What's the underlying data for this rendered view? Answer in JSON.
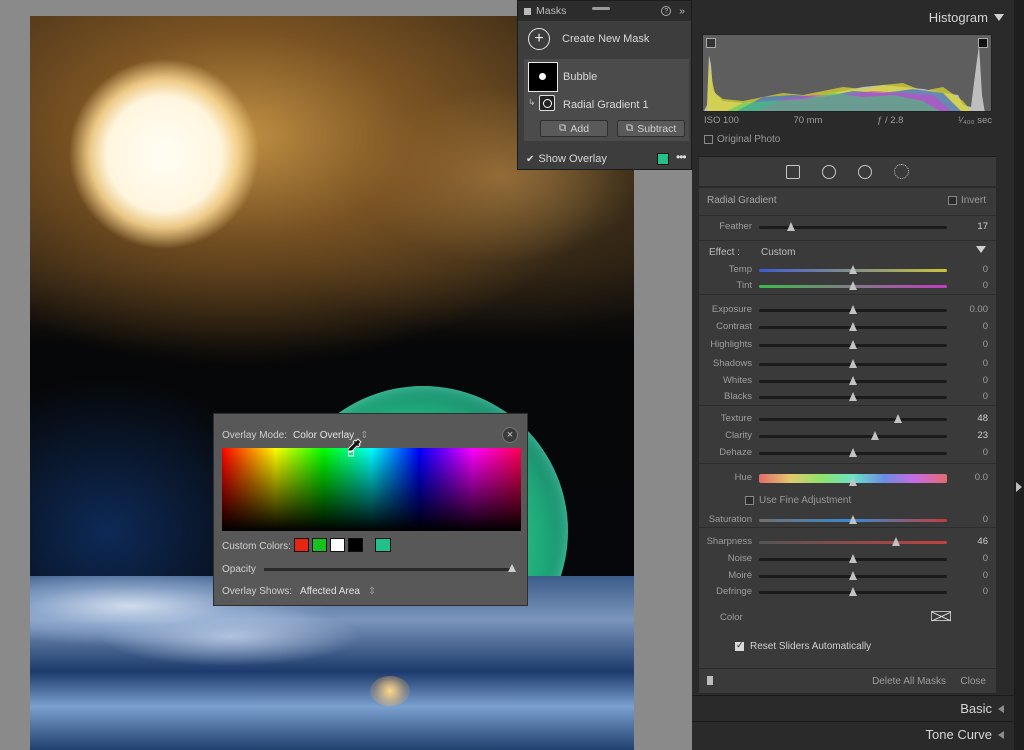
{
  "masks_panel": {
    "title": "Masks",
    "create_label": "Create New Mask",
    "mask_name": "Bubble",
    "component_name": "Radial Gradient 1",
    "add_label": "Add",
    "subtract_label": "Subtract",
    "show_overlay_label": "Show Overlay",
    "show_overlay_checked": true,
    "overlay_color": "#22c08a"
  },
  "histogram": {
    "title": "Histogram",
    "iso": "ISO 100",
    "focal": "70 mm",
    "aperture": "ƒ / 2.8",
    "shutter": "¹⁄₄₀₀ sec",
    "original_photo_label": "Original Photo"
  },
  "tools": [
    "crop-icon",
    "heal-icon",
    "redeye-icon",
    "mask-icon"
  ],
  "mask_editor": {
    "type_label": "Radial Gradient",
    "invert_label": "Invert",
    "feather": {
      "label": "Feather",
      "value": "17",
      "pos": 0.17
    },
    "effect_label": "Effect :",
    "effect_value": "Custom",
    "sliders": [
      {
        "label": "Temp",
        "value": "0",
        "pos": 0.5,
        "track": "temp"
      },
      {
        "label": "Tint",
        "value": "0",
        "pos": 0.5,
        "track": "tint"
      },
      {
        "label": "Exposure",
        "value": "0.00",
        "pos": 0.5,
        "track": "plain"
      },
      {
        "label": "Contrast",
        "value": "0",
        "pos": 0.5,
        "track": "plain"
      },
      {
        "label": "Highlights",
        "value": "0",
        "pos": 0.5,
        "track": "plain"
      },
      {
        "label": "Shadows",
        "value": "0",
        "pos": 0.5,
        "track": "plain"
      },
      {
        "label": "Whites",
        "value": "0",
        "pos": 0.5,
        "track": "plain"
      },
      {
        "label": "Blacks",
        "value": "0",
        "pos": 0.5,
        "track": "plain"
      },
      {
        "label": "Texture",
        "value": "48",
        "pos": 0.74,
        "track": "plain",
        "hi": true
      },
      {
        "label": "Clarity",
        "value": "23",
        "pos": 0.615,
        "track": "plain",
        "hi": true
      },
      {
        "label": "Dehaze",
        "value": "0",
        "pos": 0.5,
        "track": "plain"
      },
      {
        "label": "Saturation",
        "value": "0",
        "pos": 0.5,
        "track": "sat"
      },
      {
        "label": "Sharpness",
        "value": "46",
        "pos": 0.73,
        "track": "sharp",
        "hi": true
      },
      {
        "label": "Noise",
        "value": "0",
        "pos": 0.5,
        "track": "plain"
      },
      {
        "label": "Moiré",
        "value": "0",
        "pos": 0.5,
        "track": "plain"
      },
      {
        "label": "Defringe",
        "value": "0",
        "pos": 0.5,
        "track": "plain"
      }
    ],
    "hue": {
      "label": "Hue",
      "value": "0.0",
      "pos": 0.5
    },
    "fine_adjustment_label": "Use Fine Adjustment",
    "color_label": "Color",
    "reset_label": "Reset Sliders Automatically",
    "reset_checked": true,
    "delete_all_label": "Delete All Masks",
    "close_label": "Close"
  },
  "sections": {
    "basic": "Basic",
    "tone_curve": "Tone Curve"
  },
  "overlay_popup": {
    "mode_label": "Overlay Mode:",
    "mode_value": "Color Overlay",
    "custom_colors_label": "Custom Colors:",
    "custom_colors": [
      "#e8250e",
      "#15c41a",
      "#ffffff",
      "#000000"
    ],
    "selected_color": "#22c08a",
    "opacity_label": "Opacity",
    "opacity": 1.0,
    "shows_label": "Overlay Shows:",
    "shows_value": "Affected Area"
  }
}
